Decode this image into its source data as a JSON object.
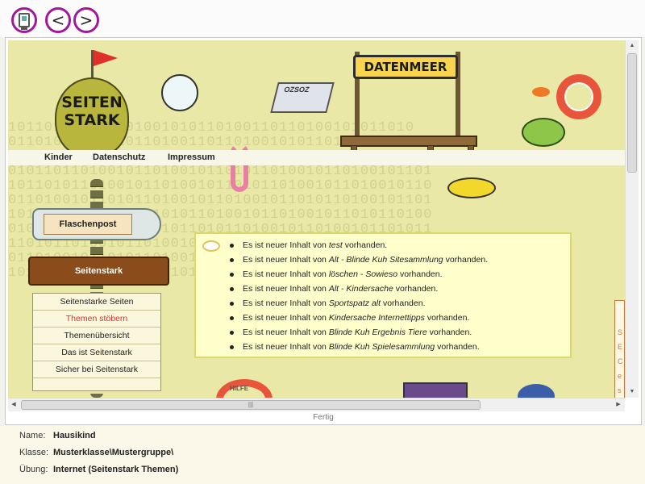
{
  "toolbar": {
    "home_icon": "monitor-icon",
    "back_label": "<",
    "forward_label": ">"
  },
  "page": {
    "nav": {
      "items": [
        {
          "label": "Kinder"
        },
        {
          "label": "Datenschutz"
        },
        {
          "label": "Impressum"
        }
      ]
    },
    "logo_text_line1": "SEITEN",
    "logo_text_line2": "STARK",
    "datenmeer_sign": "DATENMEER",
    "paper_boat_text": "OZSOZ",
    "flaschenpost_label": "Flaschenpost",
    "section_sign": "Seitenstark",
    "menu": {
      "items": [
        {
          "label": "Seitenstarke Seiten",
          "active": false
        },
        {
          "label": "Themen stöbern",
          "active": true
        },
        {
          "label": "Themenübersicht",
          "active": false
        },
        {
          "label": "Das ist Seitenstark",
          "active": false
        },
        {
          "label": "Sicher bei Seitenstark",
          "active": false
        }
      ]
    },
    "news": {
      "prefix": "Es ist neuer Inhalt von",
      "suffix": "vorhanden.",
      "items": [
        {
          "source": "test"
        },
        {
          "source": "Alt - Blinde Kuh Sitesammlung"
        },
        {
          "source": "löschen - Sowieso"
        },
        {
          "source": "Alt - Kindersache"
        },
        {
          "source": "Sportspatz alt"
        },
        {
          "source": "Kindersache Internettipps"
        },
        {
          "source": "Blinde Kuh Ergebnis Tiere"
        },
        {
          "source": "Blinde Kuh Spielesammlung"
        }
      ]
    },
    "right_card_text": "S E C e s",
    "bottom_ring_text": "HILFE"
  },
  "browser": {
    "status": "Fertig",
    "hscroll_grip": "|||"
  },
  "info": {
    "name_label": "Name:",
    "name_value": "Hausikind",
    "class_label": "Klasse:",
    "class_value": "Musterklasse\\Mustergruppe\\",
    "exercise_label": "Übung:",
    "exercise_value": "Internet (Seitenstark Themen)"
  },
  "colors": {
    "accent_purple": "#a0199a",
    "page_background": "#e9e8a6",
    "news_background": "#ffffcc",
    "active_menu_red": "#d2332a",
    "wood_sign": "#8b4c1c"
  }
}
